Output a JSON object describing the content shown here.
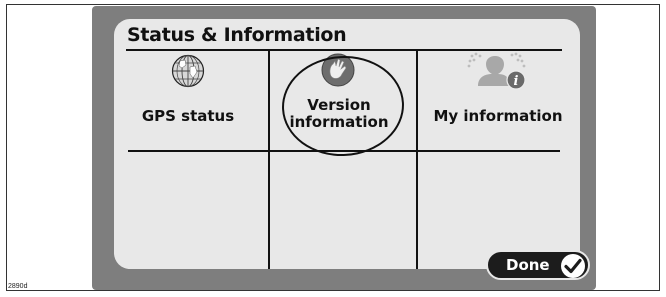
{
  "screen": {
    "title": "Status & Information"
  },
  "menu": {
    "items": [
      {
        "label": "GPS status",
        "icon": "globe-icon"
      },
      {
        "label_line1": "Version",
        "label_line2": "information",
        "icon": "hand-icon"
      },
      {
        "label": "My information",
        "icon": "info-person-icon"
      }
    ]
  },
  "footer": {
    "done_label": "Done",
    "done_icon": "checkmark-icon"
  },
  "figure_code": "2890d",
  "colors": {
    "device": "#7e7e7e",
    "screen": "#e8e8e8",
    "button": "#1c1c1c"
  }
}
